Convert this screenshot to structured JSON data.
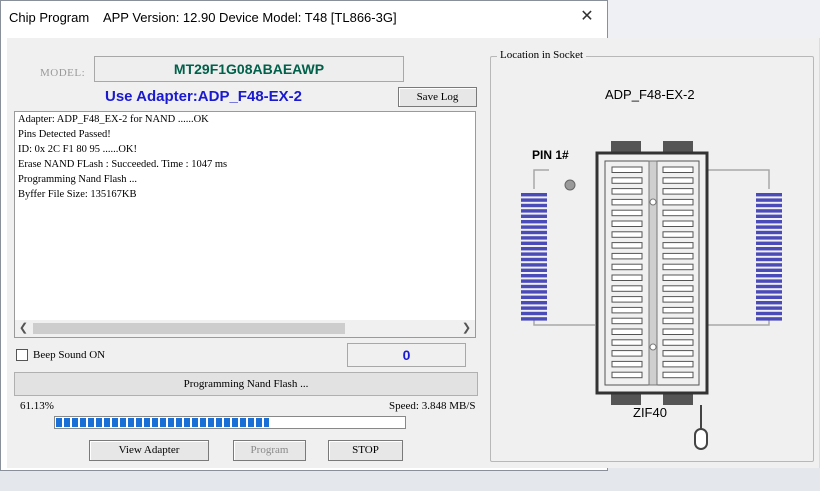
{
  "window": {
    "title": "Chip Program",
    "app_version": "APP Version: 12.90 Device Model: T48 [TL866-3G]",
    "close_glyph": "✕"
  },
  "model": {
    "label": "MODEL:",
    "value": "MT29F1G08ABAEAWP"
  },
  "adapter": {
    "label": "Use Adapter:ADP_F48-EX-2"
  },
  "buttons": {
    "save_log": "Save Log",
    "view_adapter": "View Adapter",
    "program": "Program",
    "stop": "STOP"
  },
  "log": {
    "lines": [
      "Adapter:  ADP_F48_EX-2 for NAND  ......OK",
      "Pins Detected Passed!",
      "ID: 0x 2C F1 80 95 ......OK!",
      "Erase NAND FLash : Succeeded. Time : 1047 ms",
      "Programming Nand Flash ...",
      "Byffer File Size: 135167KB"
    ]
  },
  "beep": {
    "label": "Beep Sound ON",
    "checked": false
  },
  "counter": {
    "value": "0"
  },
  "status": {
    "text": "Programming Nand Flash ..."
  },
  "progress": {
    "percent_label": "61.13%",
    "fraction": 0.6113,
    "speed": "Speed: 3.848 MB/S"
  },
  "socket": {
    "group_label": "Location in Socket",
    "adapter_name": "ADP_F48-EX-2",
    "pin1_label": "PIN 1#",
    "zif_label": "ZIF40",
    "pins_per_side": 24,
    "zif_pins_per_side": 20
  },
  "colors": {
    "pin_blue": "#4a4ab8",
    "adapter_blue": "#1a1ad0",
    "model_green": "#00604a",
    "progress_blue": "#1a6fd6"
  }
}
